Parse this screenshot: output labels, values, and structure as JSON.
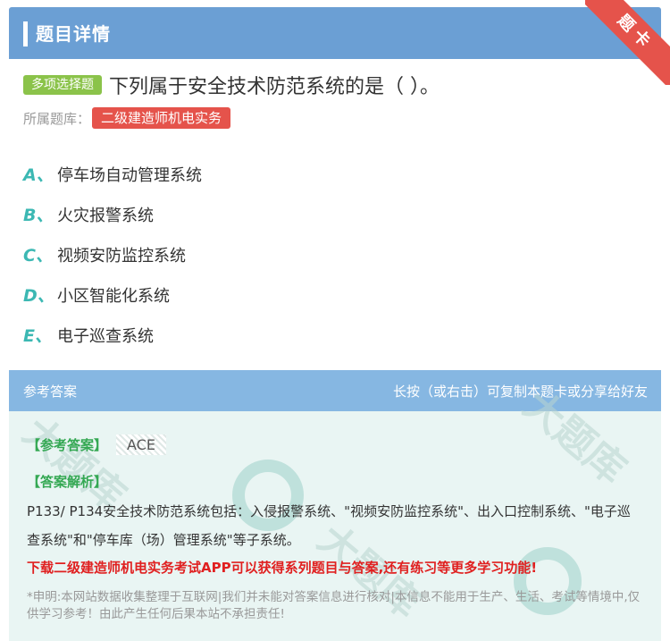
{
  "header": {
    "title": "题目详情",
    "ribbon": "题卡"
  },
  "question": {
    "type_badge": "多项选择题",
    "text": "下列属于安全技术防范系统的是（   ）。",
    "bank_label": "所属题库：",
    "bank_name": "二级建造师机电实务"
  },
  "options": [
    {
      "letter": "A、",
      "text": "停车场自动管理系统"
    },
    {
      "letter": "B、",
      "text": "火灾报警系统"
    },
    {
      "letter": "C、",
      "text": "视频安防监控系统"
    },
    {
      "letter": "D、",
      "text": "小区智能化系统"
    },
    {
      "letter": "E、",
      "text": "电子巡查系统"
    }
  ],
  "answer_section": {
    "title": "参考答案",
    "hint": "长按（或右击）可复制本题卡或分享给好友",
    "answer_label": "【参考答案】",
    "answer_value": "ACE",
    "analysis_label": "【答案解析】",
    "analysis_text": "P133/ P134安全技术防范系统包括：入侵报警系统、\"视频安防监控系统\"、出入口控制系统、\"电子巡查系统\"和\"停车库（场）管理系统\"等子系统。",
    "promo": "下载二级建造师机电实务考试APP可以获得系列题目与答案,还有练习等更多学习功能!",
    "disclaimer": "*申明:本网站数据收集整理于互联网|我们并未能对答案信息进行核对|本信息不能用于生产、生活、考试等情境中,仅供学习参考！由此产生任何后果本站不承担责任!"
  },
  "watermark": {
    "text": "大题库"
  },
  "colors": {
    "header": "#6b9fd4",
    "answer_header": "#86b7e2",
    "badge_green": "#8bc34a",
    "tag_red": "#e5534b",
    "option_letter": "#3cb8b3",
    "promo_red": "#e02020"
  }
}
